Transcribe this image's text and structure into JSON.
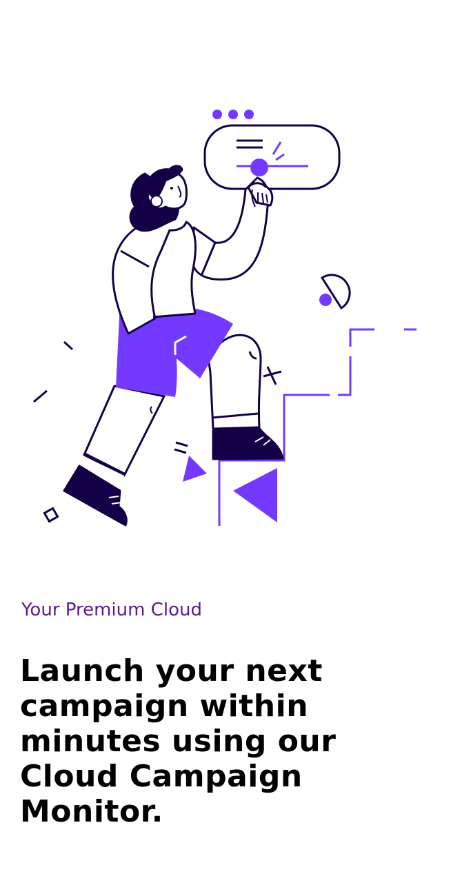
{
  "colors": {
    "accent": "#7339FF",
    "ink": "#140046",
    "eyebrow": "#5C1A8C",
    "background": "#FFFFFF"
  },
  "hero": {
    "illustration": "person-pressing-cloud-button-illustration"
  },
  "content": {
    "eyebrow": "Your Premium Cloud",
    "headline": "Launch your next campaign within minutes using our Cloud Campaign Monitor."
  }
}
